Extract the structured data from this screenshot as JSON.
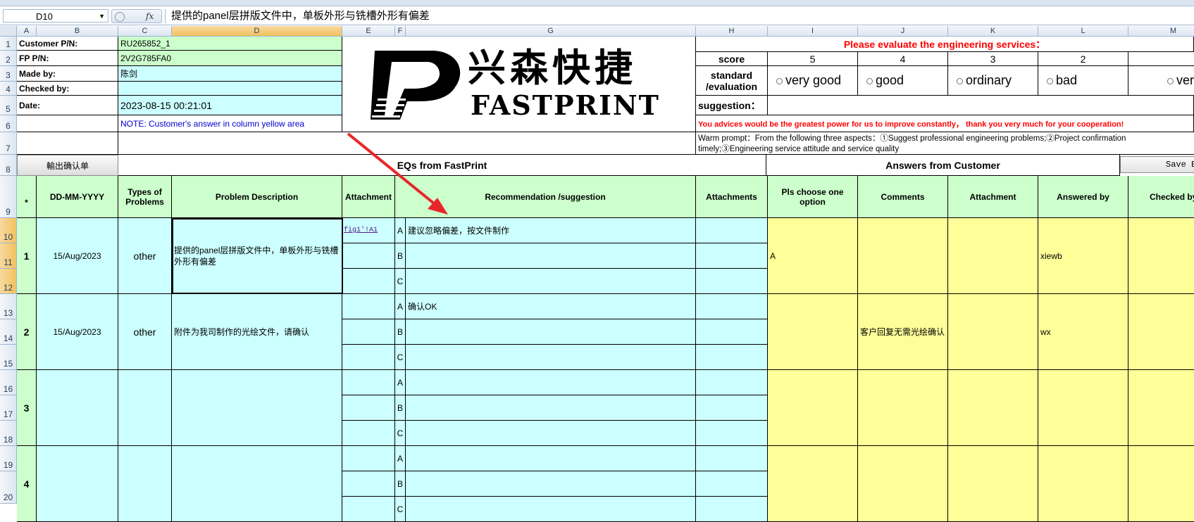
{
  "name_box": "D10",
  "formula": "提供的panel层拼版文件中，单板外形与铣槽外形有偏差",
  "columns": [
    "A",
    "B",
    "C",
    "D",
    "E",
    "F",
    "G",
    "H",
    "I",
    "J",
    "K",
    "L",
    "M"
  ],
  "rows": [
    "1",
    "2",
    "3",
    "4",
    "5",
    "6",
    "7",
    "8",
    "9",
    "10",
    "11",
    "12",
    "13",
    "14",
    "15",
    "16",
    "17",
    "18",
    "19",
    "20"
  ],
  "info": {
    "customer_label": "Customer P/N:",
    "customer_value": "RU265852_1",
    "fp_label": "FP P/N:",
    "fp_value": "2V2G785FA0",
    "made_label": "Made by:",
    "made_value": "陈剑",
    "checked_label": "Checked by:",
    "checked_value": "",
    "date_label": "Date:",
    "date_value": "2023-08-15 00:21:01",
    "note": "NOTE: Customer's  answer in column yellow area"
  },
  "logo": {
    "cn": "兴森快捷",
    "en": "FASTPRINT"
  },
  "evaluation": {
    "title": "Please evaluate the engineering services：",
    "score_label": "score",
    "scores": [
      "5",
      "4",
      "3",
      "2"
    ],
    "standard_label": "standard\n/evaluation",
    "options": [
      "very good",
      "good",
      "ordinary",
      "bad",
      "very"
    ],
    "suggestion_label": "suggestion：",
    "advice": "You advices would be the greatest power for us to improve constantly， thank you very much for your cooperation!",
    "warm_prompt": "Warm prompt：From the following three aspects：①Suggest professional engineering problems;②Project confirmation timely;③Engineering service attitude and service quality"
  },
  "export_button": "輸出确认单",
  "eq_header": "EQs from FastPrint",
  "answers_header": "Answers from Customer",
  "save_button": "Save B",
  "table_headers": {
    "star": "*",
    "date": "DD-MM-YYYY",
    "types": "Types of Problems",
    "problem": "Problem Description",
    "attachment": "Attachment",
    "recommendation": "Recommendation /suggestion",
    "attachments": "Attachments",
    "choose": "Pls choose one option",
    "comments": "Comments",
    "attachment2": "Attachment",
    "answered": "Answered by",
    "checked": "Checked by"
  },
  "eq_rows": [
    {
      "no": "1",
      "date": "15/Aug/2023",
      "type": "other",
      "problem": "提供的panel层拼版文件中，单板外形与铣槽外形有偏差",
      "attachment": "fig1'!A1",
      "opt_a": "建议忽略偏差，按文件制作",
      "opt_b": "",
      "opt_c": "",
      "choose": "A",
      "comments": "",
      "answered": "xiewb"
    },
    {
      "no": "2",
      "date": "15/Aug/2023",
      "type": "other",
      "problem": "附件为我司制作的光绘文件，请确认",
      "attachment": "",
      "opt_a": "确认OK",
      "opt_b": "",
      "opt_c": "",
      "choose": "",
      "comments": "客户回复无需光绘确认",
      "answered": "wx"
    },
    {
      "no": "3",
      "date": "",
      "type": "",
      "problem": "",
      "attachment": "",
      "opt_a": "",
      "opt_b": "",
      "opt_c": "",
      "choose": "",
      "comments": "",
      "answered": ""
    },
    {
      "no": "4",
      "date": "",
      "type": "",
      "problem": "",
      "attachment": "",
      "opt_a": "",
      "opt_b": "",
      "opt_c": "",
      "choose": "",
      "comments": "",
      "answered": ""
    }
  ],
  "option_letters": [
    "A",
    "B",
    "C"
  ],
  "colors": {
    "green": "#ccffcc",
    "cyan": "#ccffff",
    "yellow": "#ffff99",
    "red": "#ff0000",
    "arrow": "#e8262a"
  }
}
